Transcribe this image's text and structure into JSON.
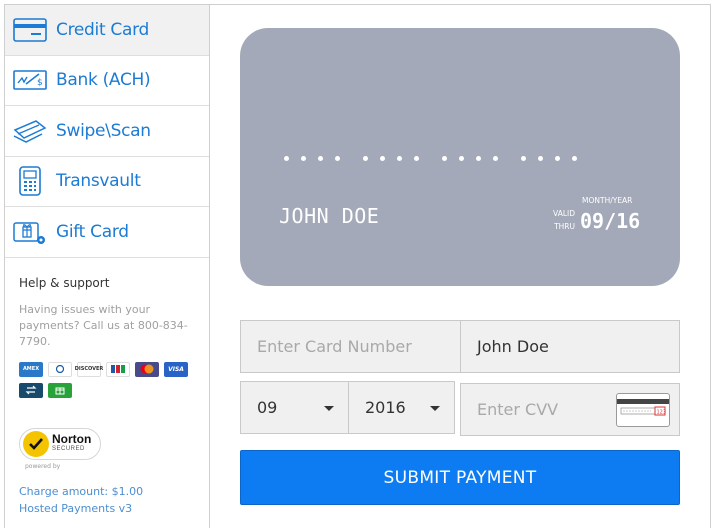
{
  "sidebar": {
    "items": [
      {
        "label": "Credit Card",
        "icon": "credit-card-icon",
        "active": true
      },
      {
        "label": "Bank (ACH)",
        "icon": "bank-check-icon",
        "active": false
      },
      {
        "label": "Swipe\\Scan",
        "icon": "swipe-card-icon",
        "active": false
      },
      {
        "label": "Transvault",
        "icon": "card-terminal-icon",
        "active": false
      },
      {
        "label": "Gift Card",
        "icon": "gift-card-icon",
        "active": false
      }
    ],
    "help_title": "Help & support",
    "help_text": "Having issues with your payments? Call us at 800-834-7790.",
    "payment_icons": [
      "amex-icon",
      "diners-icon",
      "discover-icon",
      "jcb-icon",
      "mastercard-icon",
      "visa-icon",
      "ach-transfer-icon",
      "gift-icon"
    ],
    "norton": {
      "name": "Norton",
      "secured": "SECURED",
      "powered": "powered by"
    },
    "charge_amount": "Charge amount: $1.00",
    "version": "Hosted Payments v3"
  },
  "card_preview": {
    "holder": "JOHN DOE",
    "month_year_label": "MONTH/YEAR",
    "valid_label": "VALID",
    "thru_label": "THRU",
    "expiry": "09/16"
  },
  "form": {
    "card_number_placeholder": "Enter Card Number",
    "name_value": "John Doe",
    "month_value": "09",
    "year_value": "2016",
    "cvv_placeholder": "Enter CVV",
    "submit_label": "SUBMIT PAYMENT"
  },
  "colors": {
    "accent": "#1c7bd4",
    "card_bg": "#a3a9b8",
    "submit_bg": "#0d7cf2"
  }
}
